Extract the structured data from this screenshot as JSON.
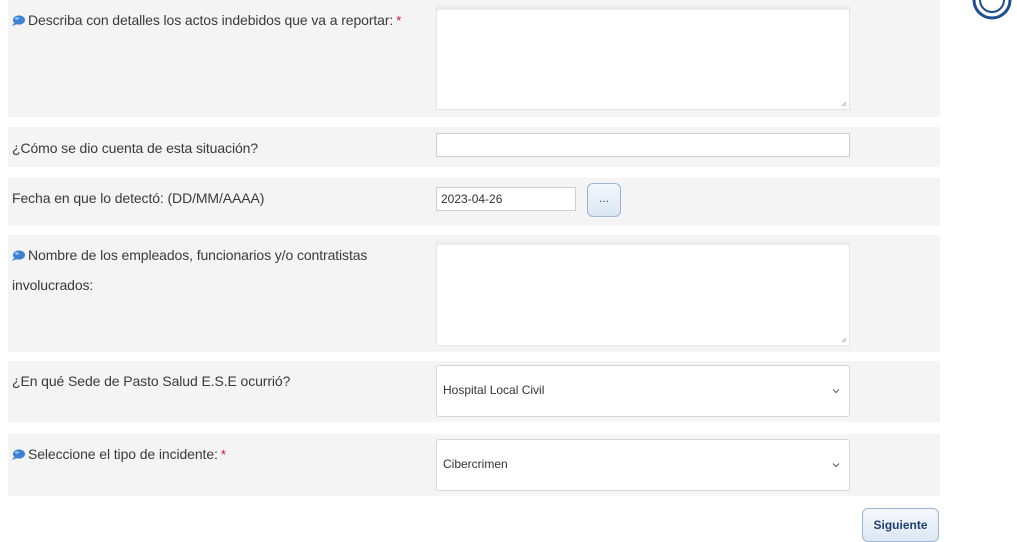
{
  "form": {
    "q_description": {
      "label": "Describa con detalles los actos indebidos que va a reportar:",
      "required_mark": "*",
      "value": ""
    },
    "q_how_known": {
      "label": "¿Cómo se dio cuenta de esta situación?",
      "value": ""
    },
    "q_date": {
      "label": "Fecha en que lo detectó: (DD/MM/AAAA)",
      "value": "2023-04-26",
      "picker_label": "..."
    },
    "q_employees": {
      "label_line1": "Nombre de los empleados, funcionarios y/o contratistas",
      "label_line2": "involucrados:",
      "value": ""
    },
    "q_site": {
      "label": "¿En qué Sede de Pasto Salud E.S.E ocurrió?",
      "selected": "Hospital Local Civil"
    },
    "q_incident": {
      "label": "Seleccione el tipo de incidente:",
      "required_mark": "*",
      "selected": "Cibercrimen"
    }
  },
  "actions": {
    "next_label": "Siguiente"
  },
  "icons": {
    "help": "help-balloon-icon",
    "chevron": "chevron-down-icon",
    "resize": "resize-grip-icon",
    "logo": "partial-logo"
  },
  "colors": {
    "row_bg": "#f4f4f5",
    "required": "#c8102e",
    "button_border": "#9db6d6",
    "help_icon": "#3b82d6"
  }
}
